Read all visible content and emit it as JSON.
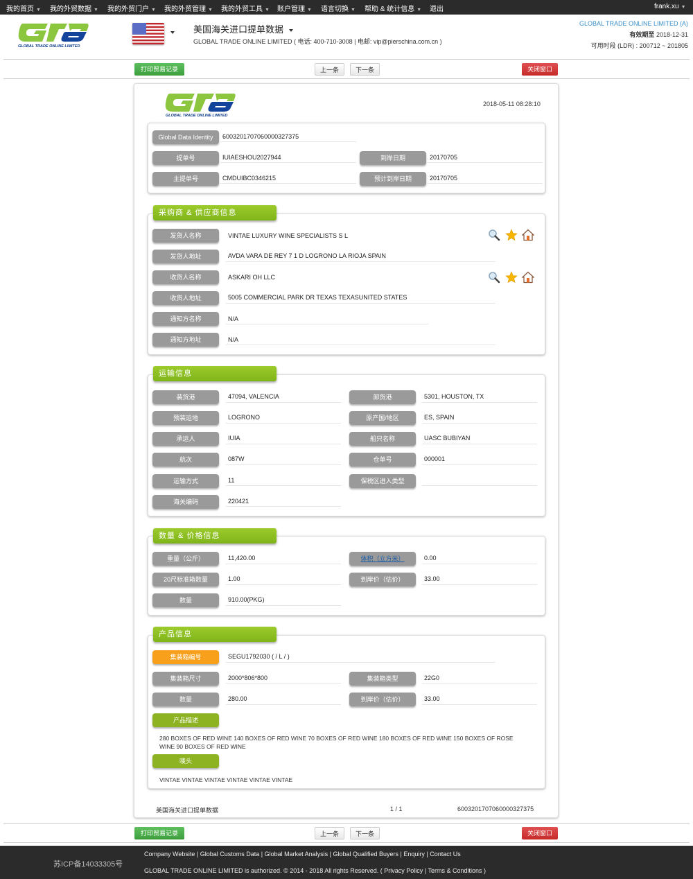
{
  "topnav": {
    "items": [
      "我的首页",
      "我的外贸数据",
      "我的外贸门户",
      "我的外贸管理",
      "我的外贸工具",
      "账户管理",
      "语言切换",
      "帮助 & 统计信息",
      "退出"
    ],
    "user": "frank.xu"
  },
  "header": {
    "logo_text": "GLOBAL TRADE ONLINE LIMITED",
    "country_flag": "usa-flag-icon",
    "title": "美国海关进口提单数据",
    "subtitle": "GLOBAL TRADE ONLINE LIMITED ( 电话:  400-710-3008  | 电邮:  vip@pierschina.com.cn )",
    "account_name": "GLOBAL TRADE ONLINE LIMITED (A)",
    "valid_label": "有效期至",
    "valid_until": "2018-12-31",
    "period_label": "可用时段 (LDR) : 200712 ~ 201805"
  },
  "toolbar": {
    "print_label": "打印贸易记录",
    "prev_label": "上一条",
    "next_label": "下一条",
    "close_label": "关闭窗口"
  },
  "record": {
    "logo_text": "GLOBAL TRADE ONLINE LIMITED",
    "datetime": "2018-05-11 08:28:10",
    "ids": {
      "gdi_label": "Global Data Identity",
      "gdi": "6003201707060000327375",
      "bl_label": "提单号",
      "bl": "IUIAESHOU2027944",
      "arrival_label": "到岸日期",
      "arrival": "20170705",
      "master_bl_label": "主提单号",
      "master_bl": "CMDUIBC0346215",
      "est_arrival_label": "预计到岸日期",
      "est_arrival": "20170705"
    },
    "parties": {
      "title": "采购商 & 供应商信息",
      "shipper_name_label": "发货人名称",
      "shipper_name": "VINTAE LUXURY WINE SPECIALISTS S L",
      "shipper_addr_label": "发货人地址",
      "shipper_addr": "AVDA VARA DE REY 7 1 D LOGRONO LA RIOJA SPAIN",
      "consignee_name_label": "收货人名称",
      "consignee_name": "ASKARI OH LLC",
      "consignee_addr_label": "收货人地址",
      "consignee_addr": "5005 COMMERCIAL PARK DR TEXAS TEXASUNITED STATES",
      "notify_name_label": "通知方名称",
      "notify_name": "N/A",
      "notify_addr_label": "通知方地址",
      "notify_addr": "N/A"
    },
    "transport": {
      "title": "运输信息",
      "rows": [
        {
          "l1": "装货港",
          "v1": "47094, VALENCIA",
          "l2": "卸货港",
          "v2": "5301, HOUSTON, TX"
        },
        {
          "l1": "预装运地",
          "v1": "LOGRONO",
          "l2": "原产国/地区",
          "v2": "ES, SPAIN"
        },
        {
          "l1": "承运人",
          "v1": "IUIA",
          "l2": "船只名称",
          "v2": "UASC BUBIYAN"
        },
        {
          "l1": "航次",
          "v1": "087W",
          "l2": "仓单号",
          "v2": "000001"
        },
        {
          "l1": "运输方式",
          "v1": "11",
          "l2": "保税区进入类型",
          "v2": ""
        },
        {
          "l1": "海关编码",
          "v1": "220421"
        }
      ]
    },
    "quantity": {
      "title": "数量 & 价格信息",
      "weight_label": "重量（公斤）",
      "weight": "11,420.00",
      "volume_label": "体积（立方米）",
      "volume": "0.00",
      "teu_label": "20尺标准箱数量",
      "teu": "1.00",
      "price_label": "到岸价（估价）",
      "price": "33.00",
      "qty_label": "数量",
      "qty": "910.00(PKG)"
    },
    "product": {
      "title": "产品信息",
      "container_no_label": "集装箱编号",
      "container_no": "SEGU1792030 ( / L / )",
      "container_size_label": "集装箱尺寸",
      "container_size": "2000*806*800",
      "container_type_label": "集装箱类型",
      "container_type": "22G0",
      "qty_label": "数量",
      "qty": "280.00",
      "price_label": "到岸价（估价）",
      "price": "33.00",
      "desc_label": "产品描述",
      "desc": "280 BOXES OF RED WINE 140 BOXES OF RED WINE 70 BOXES OF RED WINE 180 BOXES OF RED WINE 150 BOXES OF ROSE WINE 90 BOXES OF RED WINE",
      "marks_label": "唛头",
      "marks": "VINTAE VINTAE VINTAE VINTAE VINTAE VINTAE"
    },
    "footer": {
      "source": "美国海关进口提单数据",
      "page": "1 / 1",
      "gdi": "6003201707060000327375"
    }
  },
  "footer": {
    "icp": "苏ICP备14033305号",
    "links": "Company Website | Global Customs Data | Global Market Analysis | Global Qualified Buyers | Enquiry | Contact Us",
    "copyright": "GLOBAL TRADE ONLINE LIMITED is authorized. © 2014 - 2018 All rights Reserved.  (  Privacy Policy  |  Terms & Conditions  )"
  }
}
